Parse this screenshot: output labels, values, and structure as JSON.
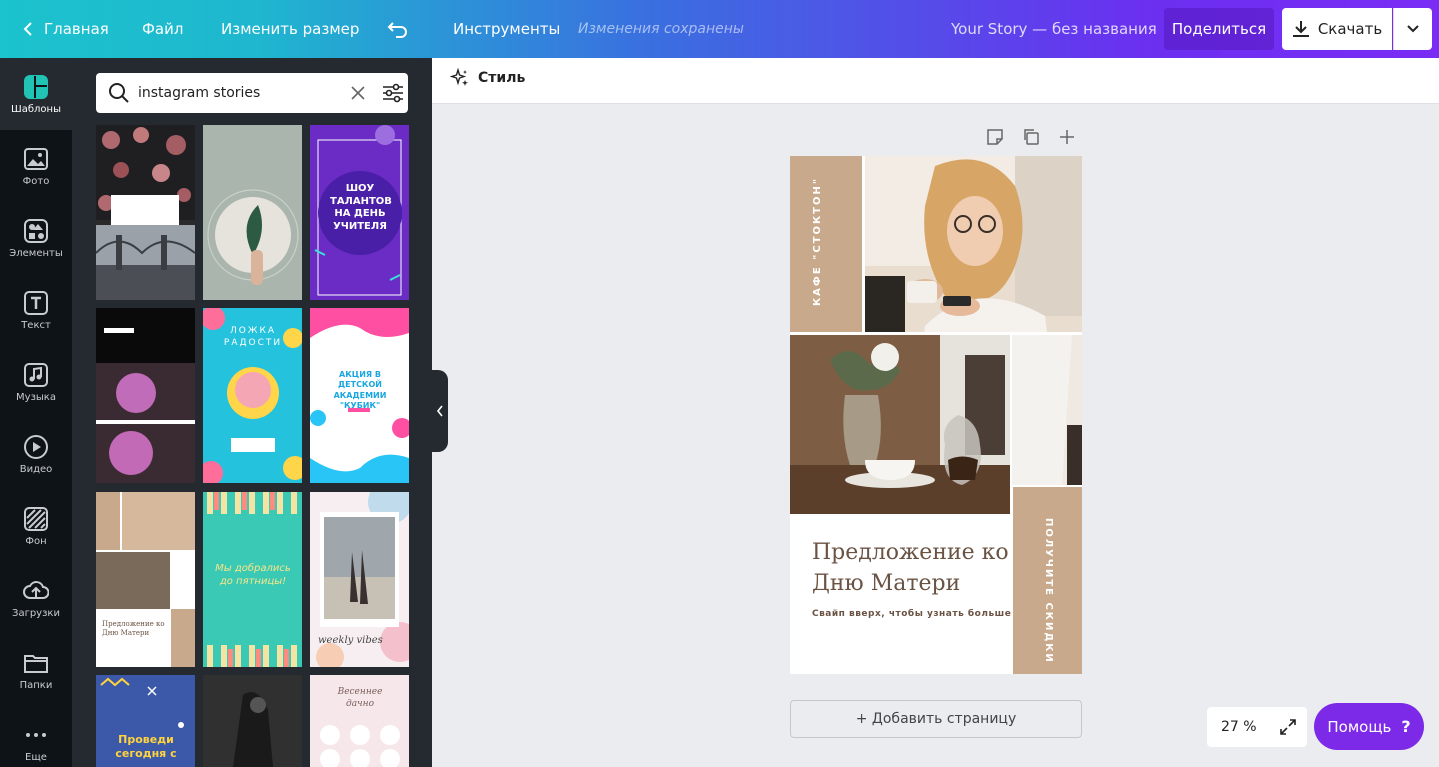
{
  "topbar": {
    "home": "Главная",
    "file": "Файл",
    "resize": "Изменить размер",
    "tools": "Инструменты",
    "saved": "Изменения сохранены",
    "doc_title": "Your Story — без названия",
    "share": "Поделиться",
    "download": "Скачать"
  },
  "rail": [
    {
      "label": "Шаблоны",
      "icon": "templates-icon"
    },
    {
      "label": "Фото",
      "icon": "photo-icon"
    },
    {
      "label": "Элементы",
      "icon": "elements-icon"
    },
    {
      "label": "Текст",
      "icon": "text-icon"
    },
    {
      "label": "Музыка",
      "icon": "music-icon"
    },
    {
      "label": "Видео",
      "icon": "video-icon"
    },
    {
      "label": "Фон",
      "icon": "background-icon"
    },
    {
      "label": "Загрузки",
      "icon": "upload-icon"
    },
    {
      "label": "Папки",
      "icon": "folder-icon"
    },
    {
      "label": "Еще",
      "icon": "more-icon"
    }
  ],
  "search": {
    "value": "instagram stories"
  },
  "thumbs": {
    "t3": "ШОУ ТАЛАНТОВ НА ДЕНЬ УЧИТЕЛЯ",
    "t5": "ЛОЖКА РАДОСТИ",
    "t6": "АКЦИЯ В ДЕТСКОЙ АКАДЕМИИ \"КУБИК\"",
    "t7": "Предложение ко Дню Матери",
    "t8": "Мы добрались до пятницы!",
    "t9": "weekly vibes",
    "t10": "Проведи сегодня с",
    "t12": "Весеннее дачно"
  },
  "style": {
    "label": "Стиль"
  },
  "canvas": {
    "side_top": "КАФЕ \"СТОКТОН\"",
    "side_bottom": "ПОЛУЧИТЕ СКИДКИ",
    "headline": "Предложение ко Дню Матери",
    "subline": "Свайп вверх, чтобы узнать больше"
  },
  "add_page": "+ Добавить страницу",
  "zoom": "27 %",
  "help": "Помощь",
  "help_mark": "?",
  "colors": {
    "accent": "#7d2ae8",
    "tan": "#c9a98b",
    "text_brown": "#6b5344"
  }
}
